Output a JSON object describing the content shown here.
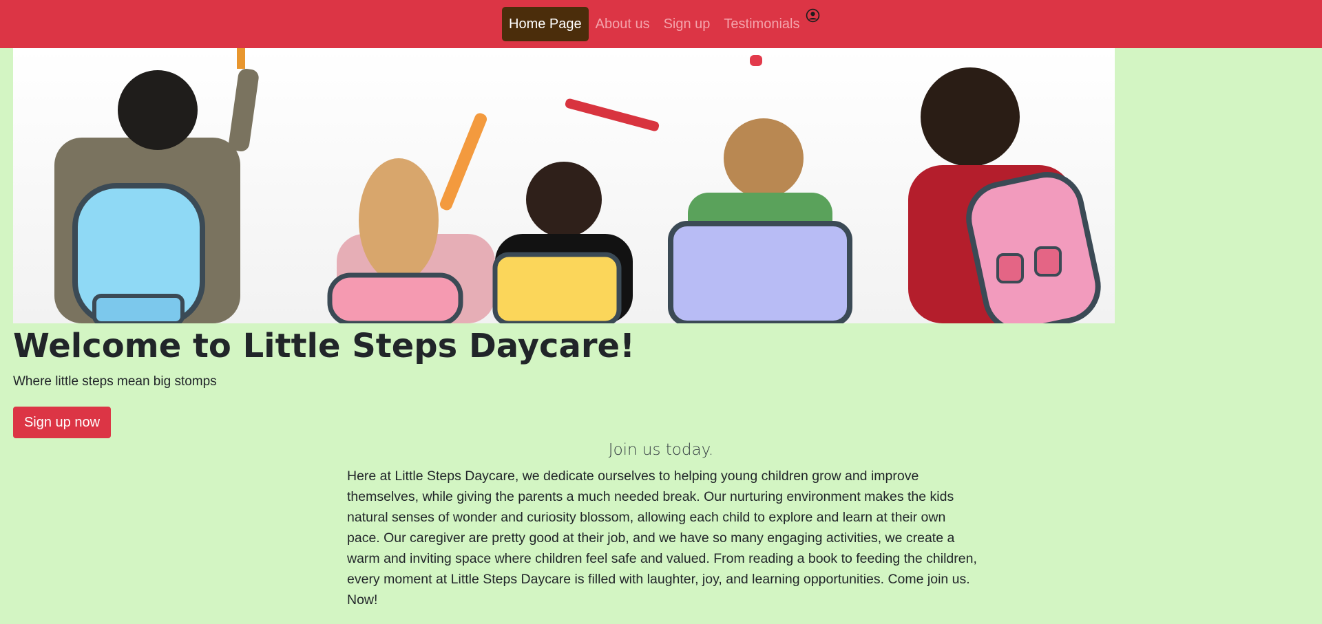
{
  "nav": {
    "items": [
      {
        "label": "Home Page",
        "active": true
      },
      {
        "label": "About us",
        "active": false
      },
      {
        "label": "Sign up",
        "active": false
      },
      {
        "label": "Testimonials",
        "active": false
      }
    ],
    "user_icon": "user-circle-icon"
  },
  "hero": {
    "image": "children-with-backpacks-drawing-on-wall"
  },
  "main": {
    "title": "Welcome to Little Steps Daycare!",
    "tagline": "Where little steps mean big stomps",
    "cta_label": "Sign up now",
    "section_heading": "Join us today.",
    "body": "Here at Little Steps Daycare, we dedicate ourselves to helping young children grow and improve themselves, while giving the parents a much needed break. Our nurturing environment makes the kids natural senses of wonder and curiosity blossom, allowing each child to explore and learn at their own pace. Our caregiver are pretty good at their job, and we have so many engaging activities, we create a warm and inviting space where children feel safe and valued. From reading a book to feeding the children, every moment at Little Steps Daycare is filled with laughter, joy, and learning opportunities. Come join us. Now!"
  },
  "colors": {
    "navbar": "#dc3545",
    "active_nav": "#4b2d0b",
    "page_background": "#d3f5c3",
    "button": "#dc3545"
  }
}
